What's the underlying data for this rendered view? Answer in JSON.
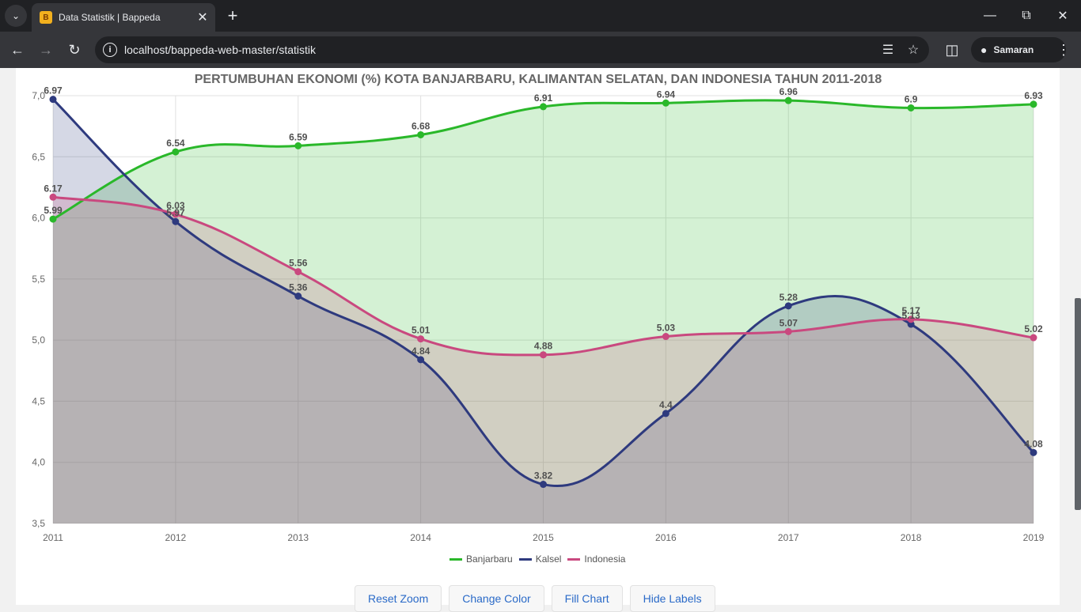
{
  "browser": {
    "tab_title": "Data Statistik | Bappeda",
    "url": "localhost/bappeda-web-master/statistik",
    "profile_label": "Samaran"
  },
  "controls": {
    "reset_zoom": "Reset Zoom",
    "change_color": "Change Color",
    "fill_chart": "Fill Chart",
    "hide_labels": "Hide Labels"
  },
  "chart_data": {
    "type": "line",
    "title": "PERTUMBUHAN EKONOMI (%) KOTA BANJARBARU, KALIMANTAN SELATAN, DAN INDONESIA TAHUN 2011-2018",
    "xlabel": "",
    "ylabel": "",
    "categories": [
      "2011",
      "2012",
      "2013",
      "2014",
      "2015",
      "2016",
      "2017",
      "2018",
      "2019"
    ],
    "y_ticks": [
      "3,5",
      "4,0",
      "4,5",
      "5,0",
      "5,5",
      "6,0",
      "6,5",
      "7,0"
    ],
    "ylim": [
      3.5,
      7.0
    ],
    "grid": true,
    "legend": "bottom",
    "series": [
      {
        "name": "Banjarbaru",
        "color": "#2ab82a",
        "fill": "rgba(42,184,42,0.2)",
        "values": [
          5.99,
          6.54,
          6.59,
          6.68,
          6.91,
          6.94,
          6.96,
          6.9,
          6.93
        ],
        "labels": [
          "5.99",
          "6.54",
          "6.59",
          "6.68",
          "6.91",
          "6.94",
          "6.96",
          "6.9",
          "6.93"
        ]
      },
      {
        "name": "Kalsel",
        "color": "#2e3a7e",
        "fill": "rgba(46,58,126,0.2)",
        "values": [
          6.97,
          5.97,
          5.36,
          4.84,
          3.82,
          4.4,
          5.28,
          5.13,
          4.08
        ],
        "labels": [
          "6.97",
          "5.97",
          "5.36",
          "4.84",
          "3.82",
          "4.4",
          "5.28",
          "5.13",
          "4.08"
        ]
      },
      {
        "name": "Indonesia",
        "color": "#c9497f",
        "fill": "rgba(201,73,127,0.2)",
        "values": [
          6.17,
          6.03,
          5.56,
          5.01,
          4.88,
          5.03,
          5.07,
          5.17,
          5.02
        ],
        "labels": [
          "6.17",
          "6.03",
          "5.56",
          "5.01",
          "4.88",
          "5.03",
          "5.07",
          "5.17",
          "5.02"
        ]
      }
    ]
  }
}
